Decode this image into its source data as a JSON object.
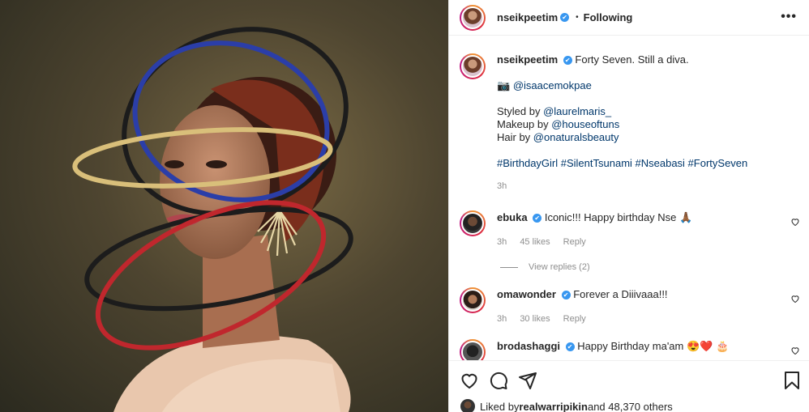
{
  "post": {
    "author": "nseikpeetim",
    "verified_mark": "✔",
    "dot": "•",
    "following": "Following",
    "more": "•••"
  },
  "caption": {
    "username": "nseikpeetim",
    "line1": "Forty Seven. Still a diva.",
    "camera_emoji": "📷",
    "photo_credit": "@isaacemokpae",
    "styled_label": "Styled by ",
    "styled_link": "@laurelmaris_",
    "makeup_label": "Makeup by ",
    "makeup_link": "@houseoftuns",
    "hair_label": "Hair by ",
    "hair_link": "@onaturalsbeauty",
    "hashtags": "#BirthdayGirl #SilentTsunami #Nseabasi #FortySeven",
    "time": "3h"
  },
  "comments": [
    {
      "username": "ebuka",
      "text": "Iconic!!! Happy birthday Nse 🙏🏾",
      "time": "3h",
      "likes": "45 likes",
      "reply": "Reply"
    },
    {
      "username": "omawonder",
      "text": "Forever a Diiivaaa!!!",
      "time": "3h",
      "likes": "30 likes",
      "reply": "Reply"
    },
    {
      "username": "brodashaggi",
      "text": "Happy Birthday ma'am 😍❤️ 🎂"
    }
  ],
  "view_replies": "View replies (2)",
  "likes_line": {
    "prefix": "Liked by ",
    "user": "realwarripikin",
    "suffix": " and 48,370 others"
  },
  "icons": [
    "heart-icon",
    "comment-icon",
    "share-icon",
    "bookmark-icon",
    "more-icon",
    "verified-icon"
  ]
}
